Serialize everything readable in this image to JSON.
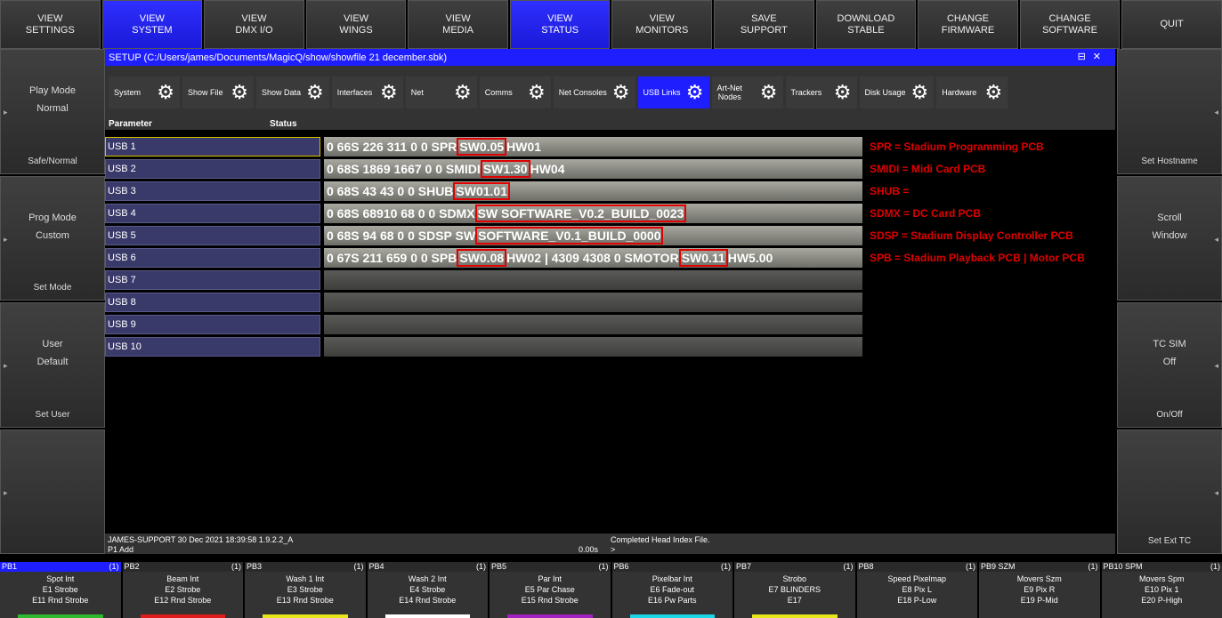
{
  "top_buttons": [
    "VIEW\nSETTINGS",
    "VIEW\nSYSTEM",
    "VIEW\nDMX I/O",
    "VIEW\nWINGS",
    "VIEW\nMEDIA",
    "VIEW\nSTATUS",
    "VIEW\nMONITORS",
    "SAVE\nSUPPORT",
    "DOWNLOAD\nSTABLE",
    "CHANGE\nFIRMWARE",
    "CHANGE\nSOFTWARE",
    "QUIT"
  ],
  "left_side": [
    {
      "l1": "Play Mode",
      "l2": "Normal",
      "bot": "Safe/Normal"
    },
    {
      "l1": "Prog Mode",
      "l2": "Custom",
      "bot": "Set Mode"
    },
    {
      "l1": "User",
      "l2": "Default",
      "bot": "Set User"
    },
    {
      "l1": "",
      "l2": "",
      "bot": ""
    }
  ],
  "right_side": [
    {
      "l1": "",
      "l2": "",
      "bot": "Set Hostname"
    },
    {
      "l1": "Scroll",
      "l2": "Window",
      "bot": ""
    },
    {
      "l1": "TC SIM",
      "l2": "Off",
      "bot": "On/Off"
    },
    {
      "l1": "",
      "l2": "",
      "bot": "Set Ext TC"
    }
  ],
  "window_title": "SETUP (C:/Users/james/Documents/MagicQ/show/showfile 21 december.sbk)",
  "tabs": [
    "System",
    "Show File",
    "Show Data",
    "Interfaces",
    "Net",
    "Comms",
    "Net Consoles",
    "USB Links",
    "Art-Net\nNodes",
    "Trackers",
    "Disk Usage",
    "Hardware"
  ],
  "col_param": "Parameter",
  "col_status": "Status",
  "rows": [
    {
      "param": "USB 1",
      "status": "0 66S 226 311 0 0 SPR ",
      "boxed": "SW0.05",
      "rest": " HW01",
      "annot": "SPR = Stadium Programming PCB"
    },
    {
      "param": "USB 2",
      "status": "0 68S 1869 1667 0 0 SMIDI ",
      "boxed": "SW1.30",
      "rest": " HW04",
      "annot": "SMIDI = Midi Card PCB"
    },
    {
      "param": "USB 3",
      "status": "0 68S 43 43 0 0 SHUB ",
      "boxed": "SW01.01",
      "rest": "",
      "annot": "SHUB ="
    },
    {
      "param": "USB 4",
      "status": "0 68S 68910 68 0 0 SDMX ",
      "boxed": "SW SOFTWARE_V0.2_BUILD_0023",
      "rest": "",
      "annot": "SDMX = DC Card PCB"
    },
    {
      "param": "USB 5",
      "status": "0 68S 94 68 0 0 SDSP SW ",
      "boxed": "SOFTWARE_V0.1_BUILD_0000",
      "rest": "",
      "annot": "SDSP = Stadium Display Controller PCB"
    },
    {
      "param": "USB 6",
      "status": "0 67S 211 659 0 0 SPB ",
      "boxed": "SW0.08",
      "rest": " HW02 | 4309 4308 0 SMOTOR ",
      "boxed2": "SW0.11",
      "rest2": " HW5.00",
      "annot": "SPB = Stadium Playback PCB | Motor PCB"
    },
    {
      "param": "USB 7",
      "status": "",
      "boxed": "",
      "rest": "",
      "annot": ""
    },
    {
      "param": "USB 8",
      "status": "",
      "boxed": "",
      "rest": "",
      "annot": ""
    },
    {
      "param": "USB 9",
      "status": "",
      "boxed": "",
      "rest": "",
      "annot": ""
    },
    {
      "param": "USB 10",
      "status": "",
      "boxed": "",
      "rest": "",
      "annot": ""
    }
  ],
  "info": {
    "line1": "JAMES-SUPPORT 30 Dec 2021 18:39:58 1.9.2.2_A",
    "line2": "P1 Add",
    "msg": "Completed Head Index File.",
    "prompt": ">",
    "time": "0.00s"
  },
  "playbacks": [
    {
      "head": "PB1",
      "count": "(1)",
      "name": "Spot Int",
      "e1": "E1 Strobe",
      "e2": "E11 Rnd Strobe",
      "color": "#2db82d"
    },
    {
      "head": "PB2",
      "count": "(1)",
      "name": "Beam Int",
      "e1": "E2 Strobe",
      "e2": "E12 Rnd Strobe",
      "color": "#e01b1b"
    },
    {
      "head": "PB3",
      "count": "(1)",
      "name": "Wash 1 Int",
      "e1": "E3 Strobe",
      "e2": "E13 Rnd Strobe",
      "color": "#e6e61a"
    },
    {
      "head": "PB4",
      "count": "(1)",
      "name": "Wash 2 Int",
      "e1": "E4 Strobe",
      "e2": "E14 Rnd Strobe",
      "color": "#ffffff"
    },
    {
      "head": "PB5",
      "count": "(1)",
      "name": "Par Int",
      "e1": "E5 Par Chase",
      "e2": "E15 Rnd Strobe",
      "color": "#a020c0"
    },
    {
      "head": "PB6",
      "count": "(1)",
      "name": "Pixelbar Int",
      "e1": "E6 Fade-out",
      "e2": "E16 Pw Parts",
      "color": "#1ad6e6"
    },
    {
      "head": "PB7",
      "count": "(1)",
      "name": "Strobo",
      "e1": "E7 BLINDERS",
      "e2": "E17",
      "color": "#e6e61a"
    },
    {
      "head": "PB8",
      "count": "(1)",
      "name": "Speed Pixelmap",
      "e1": "E8 Pix L",
      "e2": "E18 P-Low",
      "color": "#333333"
    },
    {
      "head": "PB9 SZM",
      "count": "(1)",
      "name": "Movers Szm",
      "e1": "E9 Pix R",
      "e2": "E19 P-Mid",
      "color": "#333333"
    },
    {
      "head": "PB10 SPM",
      "count": "(1)",
      "name": "Movers Spm",
      "e1": "E10 Pix 1",
      "e2": "E20 P-High",
      "color": "#333333"
    }
  ]
}
